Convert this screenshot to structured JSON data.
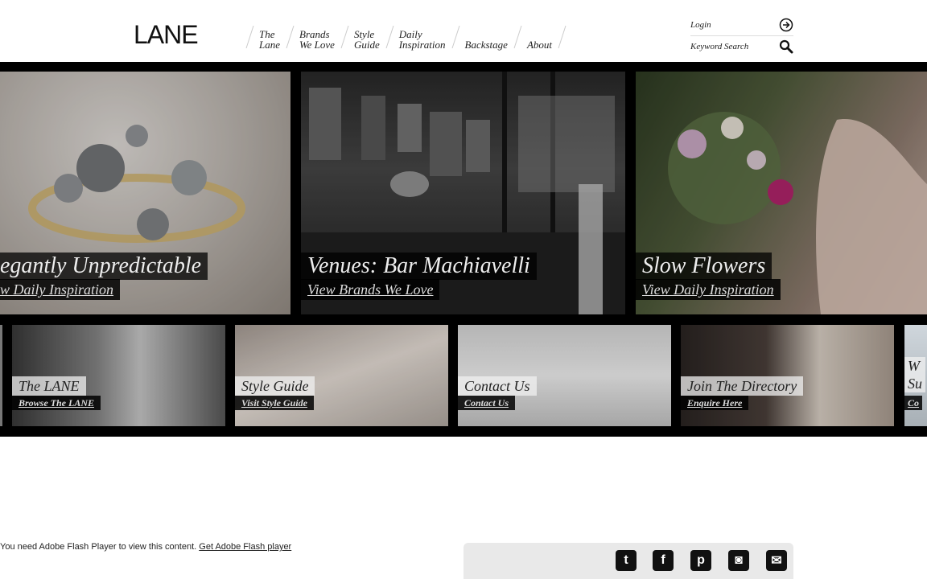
{
  "header": {
    "logo": "LANE",
    "nav": [
      {
        "label": "The\nLane"
      },
      {
        "label": "Brands\nWe Love"
      },
      {
        "label": "Style\nGuide"
      },
      {
        "label": "Daily\nInspiration"
      },
      {
        "label": "Backstage"
      },
      {
        "label": "About"
      }
    ],
    "login_label": "Login",
    "search_label": "Keyword Search"
  },
  "slides_big": [
    {
      "title": "egantly Unpredictable",
      "link": "w Daily Inspiration"
    },
    {
      "title": "Venues: Bar Machiavelli",
      "link": "View Brands We Love"
    },
    {
      "title": "Slow Flowers",
      "link": "View Daily Inspiration"
    }
  ],
  "slides_small": [
    {
      "title": "The LANE",
      "link": "Browse The LANE"
    },
    {
      "title": "Style Guide",
      "link": "Visit Style Guide"
    },
    {
      "title": "Contact Us",
      "link": "Contact Us"
    },
    {
      "title": "Join The Directory",
      "link": "Enquire Here"
    },
    {
      "title": "W\nSu",
      "link": "Co"
    }
  ],
  "footer": {
    "flash_text": "You need Adobe Flash Player to view this content.",
    "flash_link": "Get Adobe Flash player",
    "social": [
      {
        "name": "twitter",
        "glyph": "t"
      },
      {
        "name": "facebook",
        "glyph": "f"
      },
      {
        "name": "pinterest",
        "glyph": "p"
      },
      {
        "name": "instagram",
        "glyph": "◙"
      },
      {
        "name": "email",
        "glyph": "✉"
      }
    ]
  }
}
